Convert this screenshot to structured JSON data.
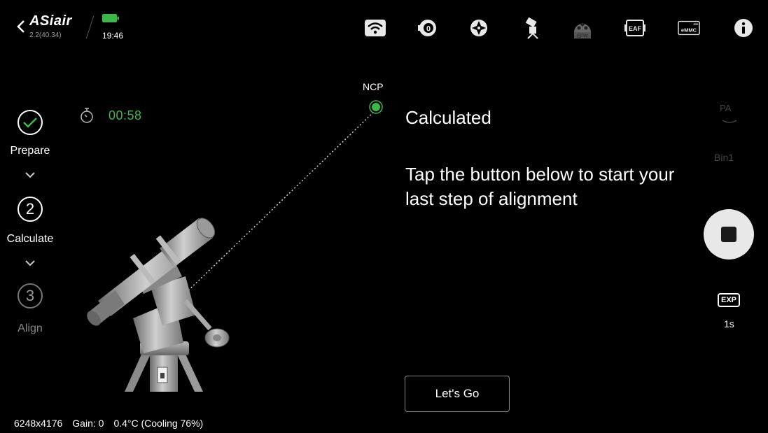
{
  "header": {
    "brand": "ASiair",
    "version": "2.2(40.34)",
    "clock": "19:46",
    "battery_color": "#3fb649",
    "icons": [
      "wifi-icon",
      "camera-icon",
      "guide-target-icon",
      "mount-icon",
      "efw-icon",
      "eaf-icon",
      "emmc-icon",
      "info-icon"
    ],
    "efw_label": "EFW",
    "eaf_label": "EAF",
    "emmc_label": "eMMC"
  },
  "steps": [
    {
      "number": "",
      "label": "Prepare",
      "state": "done"
    },
    {
      "number": "2",
      "label": "Calculate",
      "state": "active"
    },
    {
      "number": "3",
      "label": "Align",
      "state": "pending"
    }
  ],
  "timer": {
    "value": "00:58",
    "color": "#3fb649"
  },
  "target": {
    "label": "NCP",
    "color": "#3fb649"
  },
  "main": {
    "title": "Calculated",
    "instruction": "Tap the button below to start your last step of alignment",
    "button_label": "Let's Go"
  },
  "footer": {
    "resolution": "6248x4176",
    "gain": "Gain: 0",
    "temperature": "0.4°C (Cooling 76%)"
  },
  "right_panel": {
    "pa_label": "PA",
    "bin_label": "Bin1",
    "exp_label": "EXP",
    "exp_value": "1s"
  }
}
